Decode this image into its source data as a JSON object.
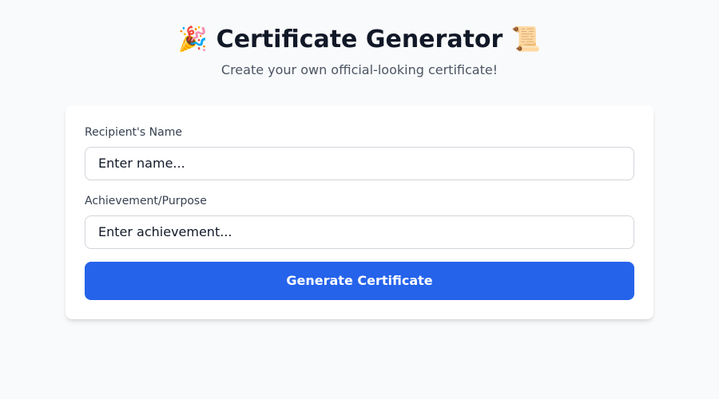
{
  "header": {
    "title": "🎉 Certificate Generator 📜",
    "subtitle": "Create your own official-looking certificate!"
  },
  "form": {
    "recipient": {
      "label": "Recipient's Name",
      "placeholder": "Enter name...",
      "value": ""
    },
    "achievement": {
      "label": "Achievement/Purpose",
      "placeholder": "Enter achievement...",
      "value": ""
    },
    "submit_label": "Generate Certificate"
  }
}
